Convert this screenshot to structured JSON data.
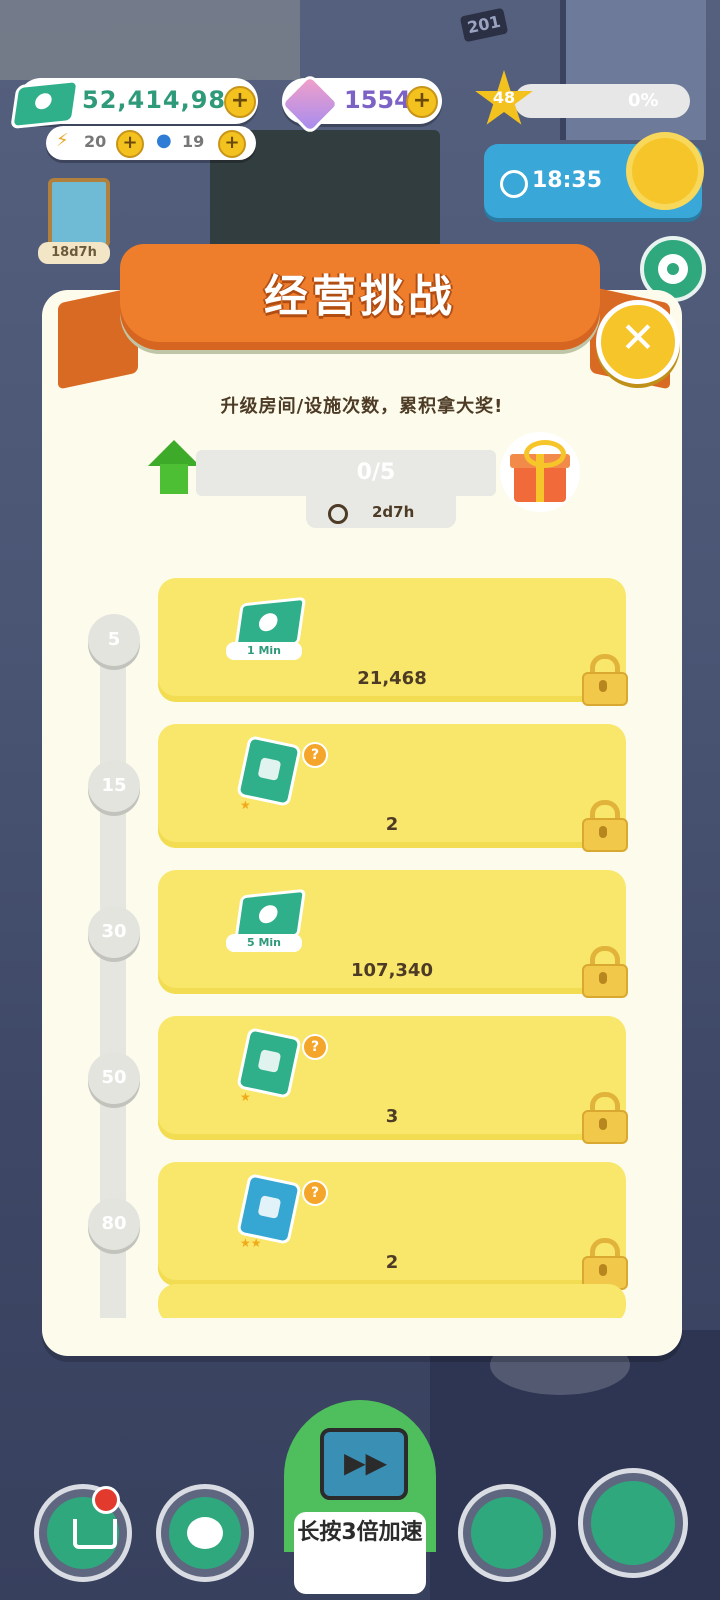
{
  "hud": {
    "money": "52,414,980",
    "energy": "20",
    "water": "19",
    "gems": "1554",
    "level": "48",
    "level_progress": "0%",
    "clock": "18:35",
    "book_timer": "18d7h",
    "room_number": "201",
    "plus": "+"
  },
  "modal": {
    "title": "经营挑战",
    "close": "✕",
    "subtitle": "升级房间/设施次数，累积拿大奖!",
    "progress": "0/5",
    "timer": "2d7h"
  },
  "milestones": [
    {
      "threshold": "5",
      "reward_tag": "1 Min",
      "amount": "21,468"
    },
    {
      "threshold": "15",
      "amount": "2"
    },
    {
      "threshold": "30",
      "reward_tag": "5 Min",
      "amount": "107,340"
    },
    {
      "threshold": "50",
      "amount": "3"
    },
    {
      "threshold": "80",
      "amount": "2"
    }
  ],
  "bottom": {
    "speed_label": "长按3倍加速"
  },
  "colors": {
    "banner": "#ee7e2c",
    "card": "#f8e76a",
    "green": "#2fb08a",
    "close": "#f6c52a"
  }
}
